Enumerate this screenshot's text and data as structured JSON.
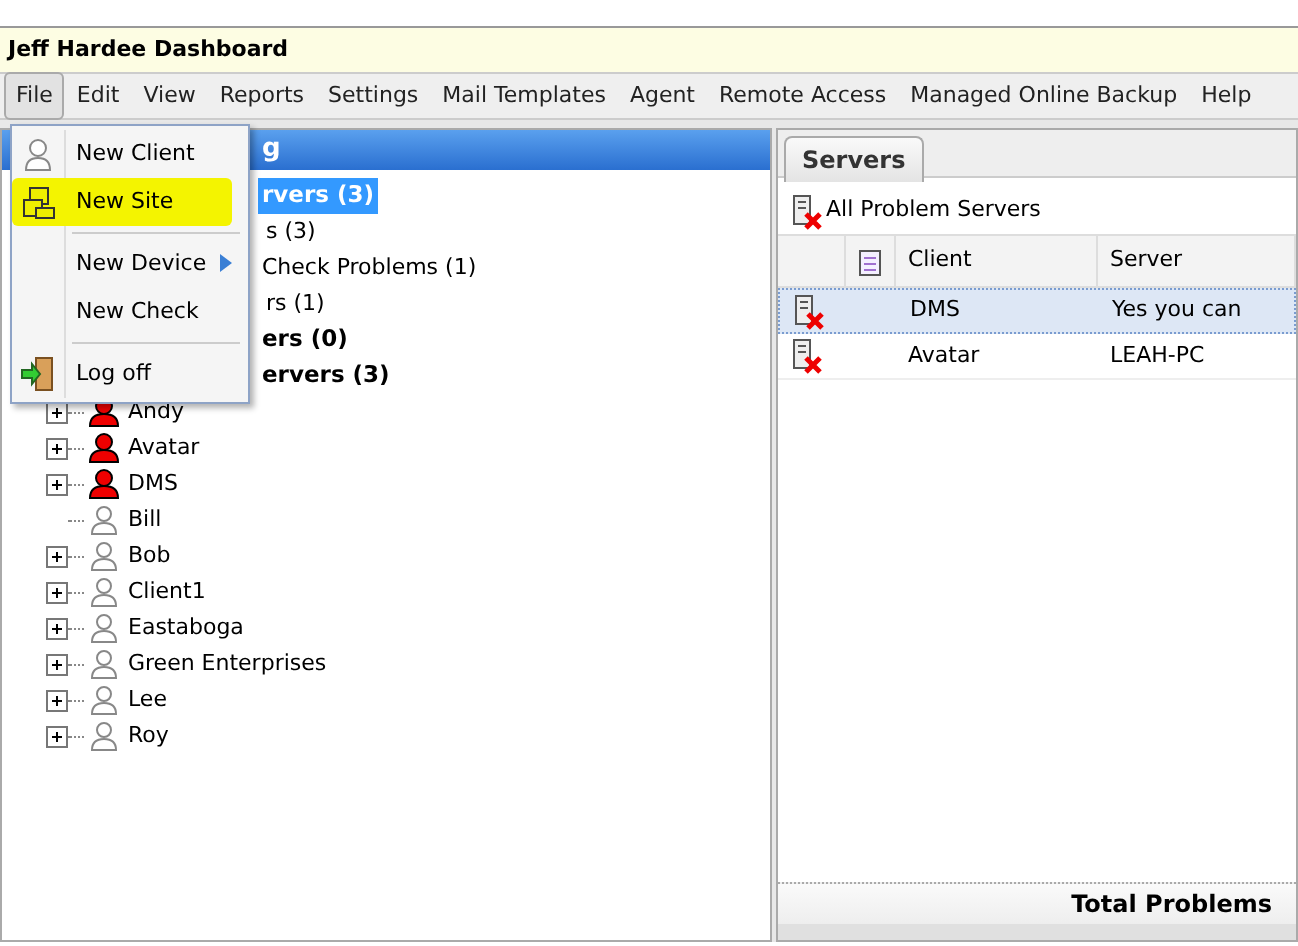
{
  "window": {
    "title": "Jeff Hardee Dashboard"
  },
  "menu_bar": [
    {
      "label": "File",
      "selected": true
    },
    {
      "label": "Edit",
      "selected": false
    },
    {
      "label": "View",
      "selected": false
    },
    {
      "label": "Reports",
      "selected": false
    },
    {
      "label": "Settings",
      "selected": false
    },
    {
      "label": "Mail Templates",
      "selected": false
    },
    {
      "label": "Agent",
      "selected": false
    },
    {
      "label": "Remote Access",
      "selected": false
    },
    {
      "label": "Managed Online Backup",
      "selected": false
    },
    {
      "label": "Help",
      "selected": false
    }
  ],
  "file_menu": [
    {
      "kind": "client",
      "label": "New Client",
      "highlighted": false,
      "submenu": false
    },
    {
      "kind": "site",
      "label": "New Site",
      "highlighted": true,
      "submenu": false
    },
    {
      "kind": "separator"
    },
    {
      "kind": "plain",
      "label": "New Device",
      "highlighted": false,
      "submenu": true
    },
    {
      "kind": "plain",
      "label": "New Check",
      "highlighted": false,
      "submenu": false
    },
    {
      "kind": "separator"
    },
    {
      "kind": "logoff",
      "label": "Log off",
      "highlighted": false,
      "submenu": false
    }
  ],
  "tree": {
    "header": "g",
    "groups": [
      {
        "label": "rvers (3)",
        "bold": true,
        "selected": true
      },
      {
        "label": "s (3)",
        "bold": false,
        "selected": false
      },
      {
        "label": "Check Problems (1)",
        "bold": false,
        "selected": false
      },
      {
        "label": "rs (1)",
        "bold": false,
        "selected": false
      },
      {
        "label": "ers (0)",
        "bold": true,
        "selected": false
      },
      {
        "label": "ervers (3)",
        "bold": true,
        "selected": false,
        "children": [
          {
            "label": "Andy",
            "alert": true,
            "expandable": true
          },
          {
            "label": "Avatar",
            "alert": true,
            "expandable": true
          },
          {
            "label": "DMS",
            "alert": true,
            "expandable": true
          },
          {
            "label": "Bill",
            "alert": false,
            "expandable": false
          },
          {
            "label": "Bob",
            "alert": false,
            "expandable": true
          },
          {
            "label": "Client1",
            "alert": false,
            "expandable": true
          },
          {
            "label": "Eastaboga",
            "alert": false,
            "expandable": true
          },
          {
            "label": "Green Enterprises",
            "alert": false,
            "expandable": true
          },
          {
            "label": "Lee",
            "alert": false,
            "expandable": true
          },
          {
            "label": "Roy",
            "alert": false,
            "expandable": true
          }
        ]
      }
    ]
  },
  "servers_panel": {
    "tabs": [
      {
        "label": "Servers",
        "selected": true
      }
    ],
    "toolbar_title": "All Problem Servers",
    "columns": [
      "Client",
      "Server"
    ],
    "rows": [
      {
        "client": "DMS",
        "server": "Yes you can",
        "selected": true
      },
      {
        "client": "Avatar",
        "server": "LEAH-PC",
        "selected": false
      }
    ],
    "footer": "Total Problems"
  }
}
